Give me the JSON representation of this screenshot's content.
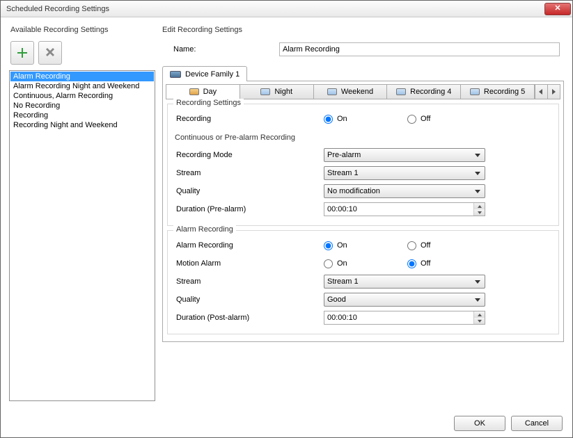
{
  "window": {
    "title": "Scheduled Recording Settings"
  },
  "left": {
    "heading": "Available Recording Settings",
    "items": [
      "Alarm Recording",
      "Alarm Recording Night and Weekend",
      "Continuous, Alarm Recording",
      "No Recording",
      "Recording",
      "Recording Night and Weekend"
    ],
    "selected_index": 0
  },
  "edit": {
    "heading": "Edit Recording Settings",
    "name_label": "Name:",
    "name_value": "Alarm Recording",
    "device_tab": "Device Family 1",
    "rec_tabs": [
      "Day",
      "Night",
      "Weekend",
      "Recording 4",
      "Recording 5"
    ],
    "active_rec_tab": 0
  },
  "recording_settings": {
    "group_title": "Recording Settings",
    "recording_label": "Recording",
    "on": "On",
    "off": "Off",
    "recording_value": "On",
    "cont_title": "Continuous or Pre-alarm Recording",
    "mode_label": "Recording Mode",
    "mode_value": "Pre-alarm",
    "stream_label": "Stream",
    "stream_value": "Stream 1",
    "quality_label": "Quality",
    "quality_value": "No modification",
    "duration_pre_label": "Duration (Pre-alarm)",
    "duration_pre_value": "00:00:10"
  },
  "alarm_recording": {
    "group_title": "Alarm Recording",
    "alarm_rec_label": "Alarm Recording",
    "alarm_rec_value": "On",
    "motion_label": "Motion Alarm",
    "motion_value": "Off",
    "stream_label": "Stream",
    "stream_value": "Stream 1",
    "quality_label": "Quality",
    "quality_value": "Good",
    "duration_post_label": "Duration (Post-alarm)",
    "duration_post_value": "00:00:10",
    "on": "On",
    "off": "Off"
  },
  "footer": {
    "ok": "OK",
    "cancel": "Cancel"
  }
}
